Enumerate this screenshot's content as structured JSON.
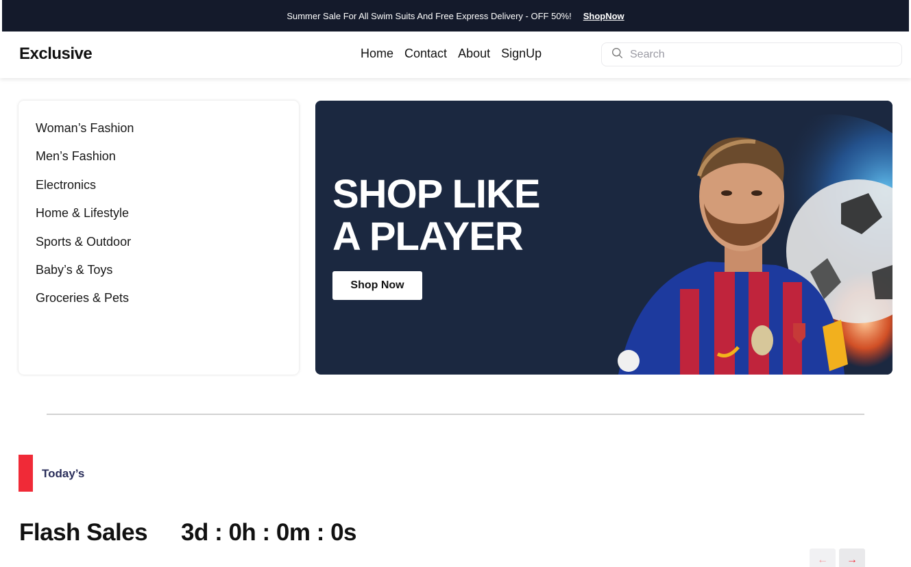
{
  "announcement": {
    "text": "Summer Sale For All Swim Suits And Free Express Delivery - OFF 50%!",
    "link": "ShopNow"
  },
  "header": {
    "logo": "Exclusive",
    "nav": [
      "Home",
      "Contact",
      "About",
      "SignUp"
    ],
    "search_placeholder": "Search",
    "search_icon": "search-icon"
  },
  "categories": [
    "Woman’s Fashion",
    "Men’s Fashion",
    "Electronics",
    "Home & Lifestyle",
    "Sports & Outdoor",
    "Baby’s & Toys",
    "Groceries & Pets"
  ],
  "hero": {
    "title_line1": "SHOP LIKE",
    "title_line2": "A PLAYER",
    "button": "Shop Now",
    "background_color": "#1b2840"
  },
  "section": {
    "tag": "Today’s",
    "title": "Flash Sales",
    "countdown": "3d : 0h : 0m : 0s",
    "accent_color": "#f02a37",
    "prev_icon": "arrow-left-icon",
    "next_icon": "arrow-right-icon"
  }
}
